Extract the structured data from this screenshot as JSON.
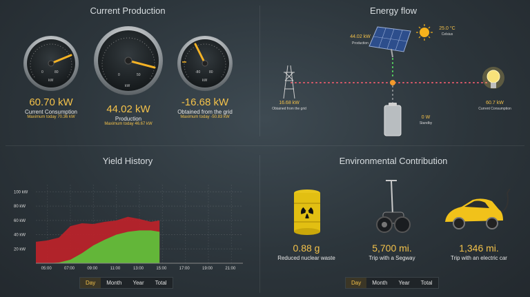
{
  "current_production": {
    "title": "Current Production",
    "gauges": [
      {
        "value": "60.70 kW",
        "label": "Current Consumption",
        "max": "Maximum today 70.36 kW",
        "scale_left": "0",
        "scale_right": "80",
        "unit": "kW"
      },
      {
        "value": "44.02 kW",
        "label": "Production",
        "max": "Maximum today 46.67 kW",
        "scale_left": "0",
        "scale_right": "50",
        "unit": "kW"
      },
      {
        "value": "-16.68 kW",
        "label": "Obtained from the grid",
        "max": "Maximum today -50.83 kW",
        "scale_left": "-80",
        "scale_right": "80",
        "unit": "kW"
      }
    ]
  },
  "energy_flow": {
    "title": "Energy flow",
    "production_value": "44.02 kW",
    "production_label": "Production",
    "temperature": "25.0 °C",
    "weather": "Celsius",
    "grid_value": "16.68 kW",
    "grid_label": "Obtained from the grid",
    "consumption_value": "60.7 kW",
    "consumption_label": "Current Consumption",
    "storage_value": "0 W",
    "storage_label": "Standby"
  },
  "yield_history": {
    "title": "Yield History",
    "tabs": [
      "Day",
      "Month",
      "Year",
      "Total"
    ],
    "active_tab": "Day"
  },
  "chart_data": {
    "type": "area",
    "title": "Yield History",
    "x": [
      "04:00",
      "05:00",
      "06:00",
      "07:00",
      "08:00",
      "09:00",
      "10:00",
      "11:00",
      "12:00",
      "13:00",
      "14:00",
      "14:45"
    ],
    "xticks": [
      "05:00",
      "07:00",
      "09:00",
      "11:00",
      "13:00",
      "15:00",
      "17:00",
      "19:00",
      "21:00"
    ],
    "yticks": [
      "100 kW",
      "80 kW",
      "60 kW",
      "40 kW",
      "20 kW"
    ],
    "ylim": [
      0,
      110
    ],
    "series": [
      {
        "name": "",
        "color": "#b8232a",
        "values": [
          30,
          32,
          36,
          52,
          56,
          55,
          58,
          60,
          65,
          62,
          58,
          60
        ]
      },
      {
        "name": "",
        "color": "#5fbf3a",
        "values": [
          0,
          0,
          1,
          5,
          14,
          25,
          33,
          40,
          44,
          46,
          46,
          44
        ]
      }
    ]
  },
  "environmental": {
    "title": "Environmental Contribution",
    "tabs": [
      "Day",
      "Month",
      "Year",
      "Total"
    ],
    "active_tab": "Day",
    "items": [
      {
        "value": "0.88 g",
        "label": "Reduced nuclear waste",
        "icon": "nuclear-barrel-icon"
      },
      {
        "value": "5,700 mi.",
        "label": "Trip with a Segway",
        "icon": "segway-icon"
      },
      {
        "value": "1,346 mi.",
        "label": "Trip with an electric car",
        "icon": "electric-car-icon"
      }
    ]
  },
  "colors": {
    "accent": "#f4c24a",
    "production_fill": "#5fbf3a",
    "consumption_fill": "#b8232a"
  }
}
